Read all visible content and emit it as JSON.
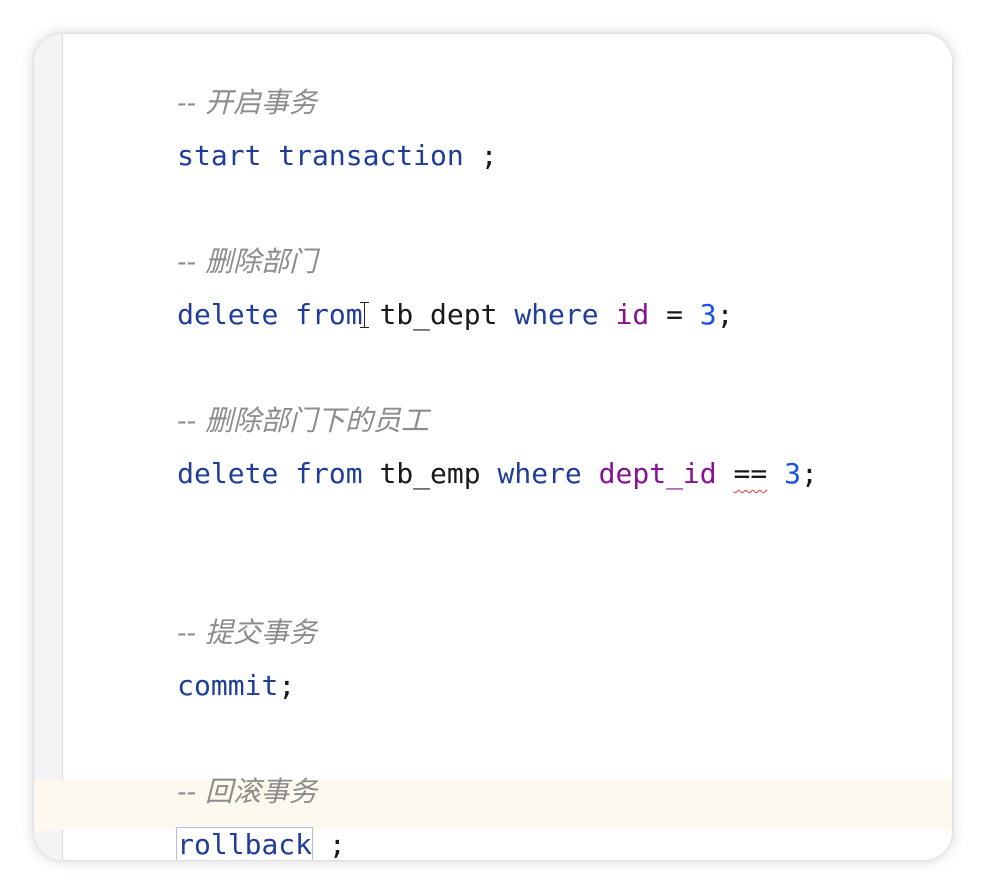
{
  "editor": {
    "lines": {
      "comment_start": "-- 开启事务",
      "start_kw": "start transaction",
      "start_end": " ;",
      "comment_delete_dept": "-- 删除部门",
      "dd_delete": "delete",
      "dd_from": "from",
      "dd_table": "tb_dept",
      "dd_where": "where",
      "dd_col": "id",
      "dd_op": " = ",
      "dd_val": "3",
      "dd_end": ";",
      "comment_delete_emp": "-- 删除部门下的员工",
      "de_delete": "delete",
      "de_from": "from",
      "de_table": "tb_emp",
      "de_where": "where",
      "de_col": "dept_id",
      "de_op": "==",
      "de_val": "3",
      "de_end": ";",
      "comment_commit": "-- 提交事务",
      "commit_kw": "commit",
      "commit_end": ";",
      "comment_rollback": "-- 回滚事务",
      "rollback_kw": "rollback",
      "rollback_end": " ;"
    }
  },
  "colors": {
    "keyword": "#1f3d99",
    "column": "#871094",
    "number": "#1750eb",
    "comment": "#8c8c8c",
    "current_line": "#fdf9ee",
    "error_underline": "#e03c3c"
  }
}
